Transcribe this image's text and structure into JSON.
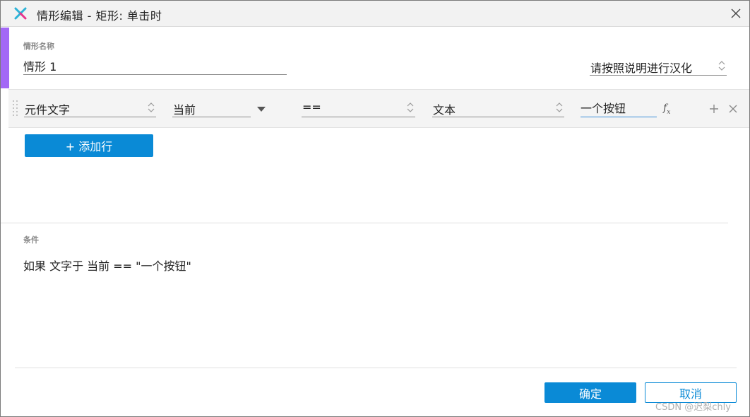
{
  "window": {
    "title": "情形编辑  -  矩形: 单击时",
    "close_icon": "close-icon",
    "logo_icon": "axure-logo-icon"
  },
  "case": {
    "name_label": "情形名称",
    "name_value": "情形 1",
    "match_select": "请按照说明进行汉化"
  },
  "condition_row": {
    "target_type": "元件文字",
    "target": "当前",
    "operator": "==",
    "value_type": "文本",
    "value": "一个按钮",
    "fx_label": "f",
    "fx_sub": "x",
    "add_icon": "plus-icon",
    "remove_icon": "close-icon"
  },
  "add_row_button": "+ 添加行",
  "condition_section": {
    "label": "条件",
    "summary": "如果 文字于 当前 == \"一个按钮\""
  },
  "footer": {
    "ok": "确定",
    "cancel": "取消"
  },
  "watermark": "CSDN @迟梨chly",
  "colors": {
    "accent": "#a368f6",
    "primary": "#0a8ad6"
  }
}
